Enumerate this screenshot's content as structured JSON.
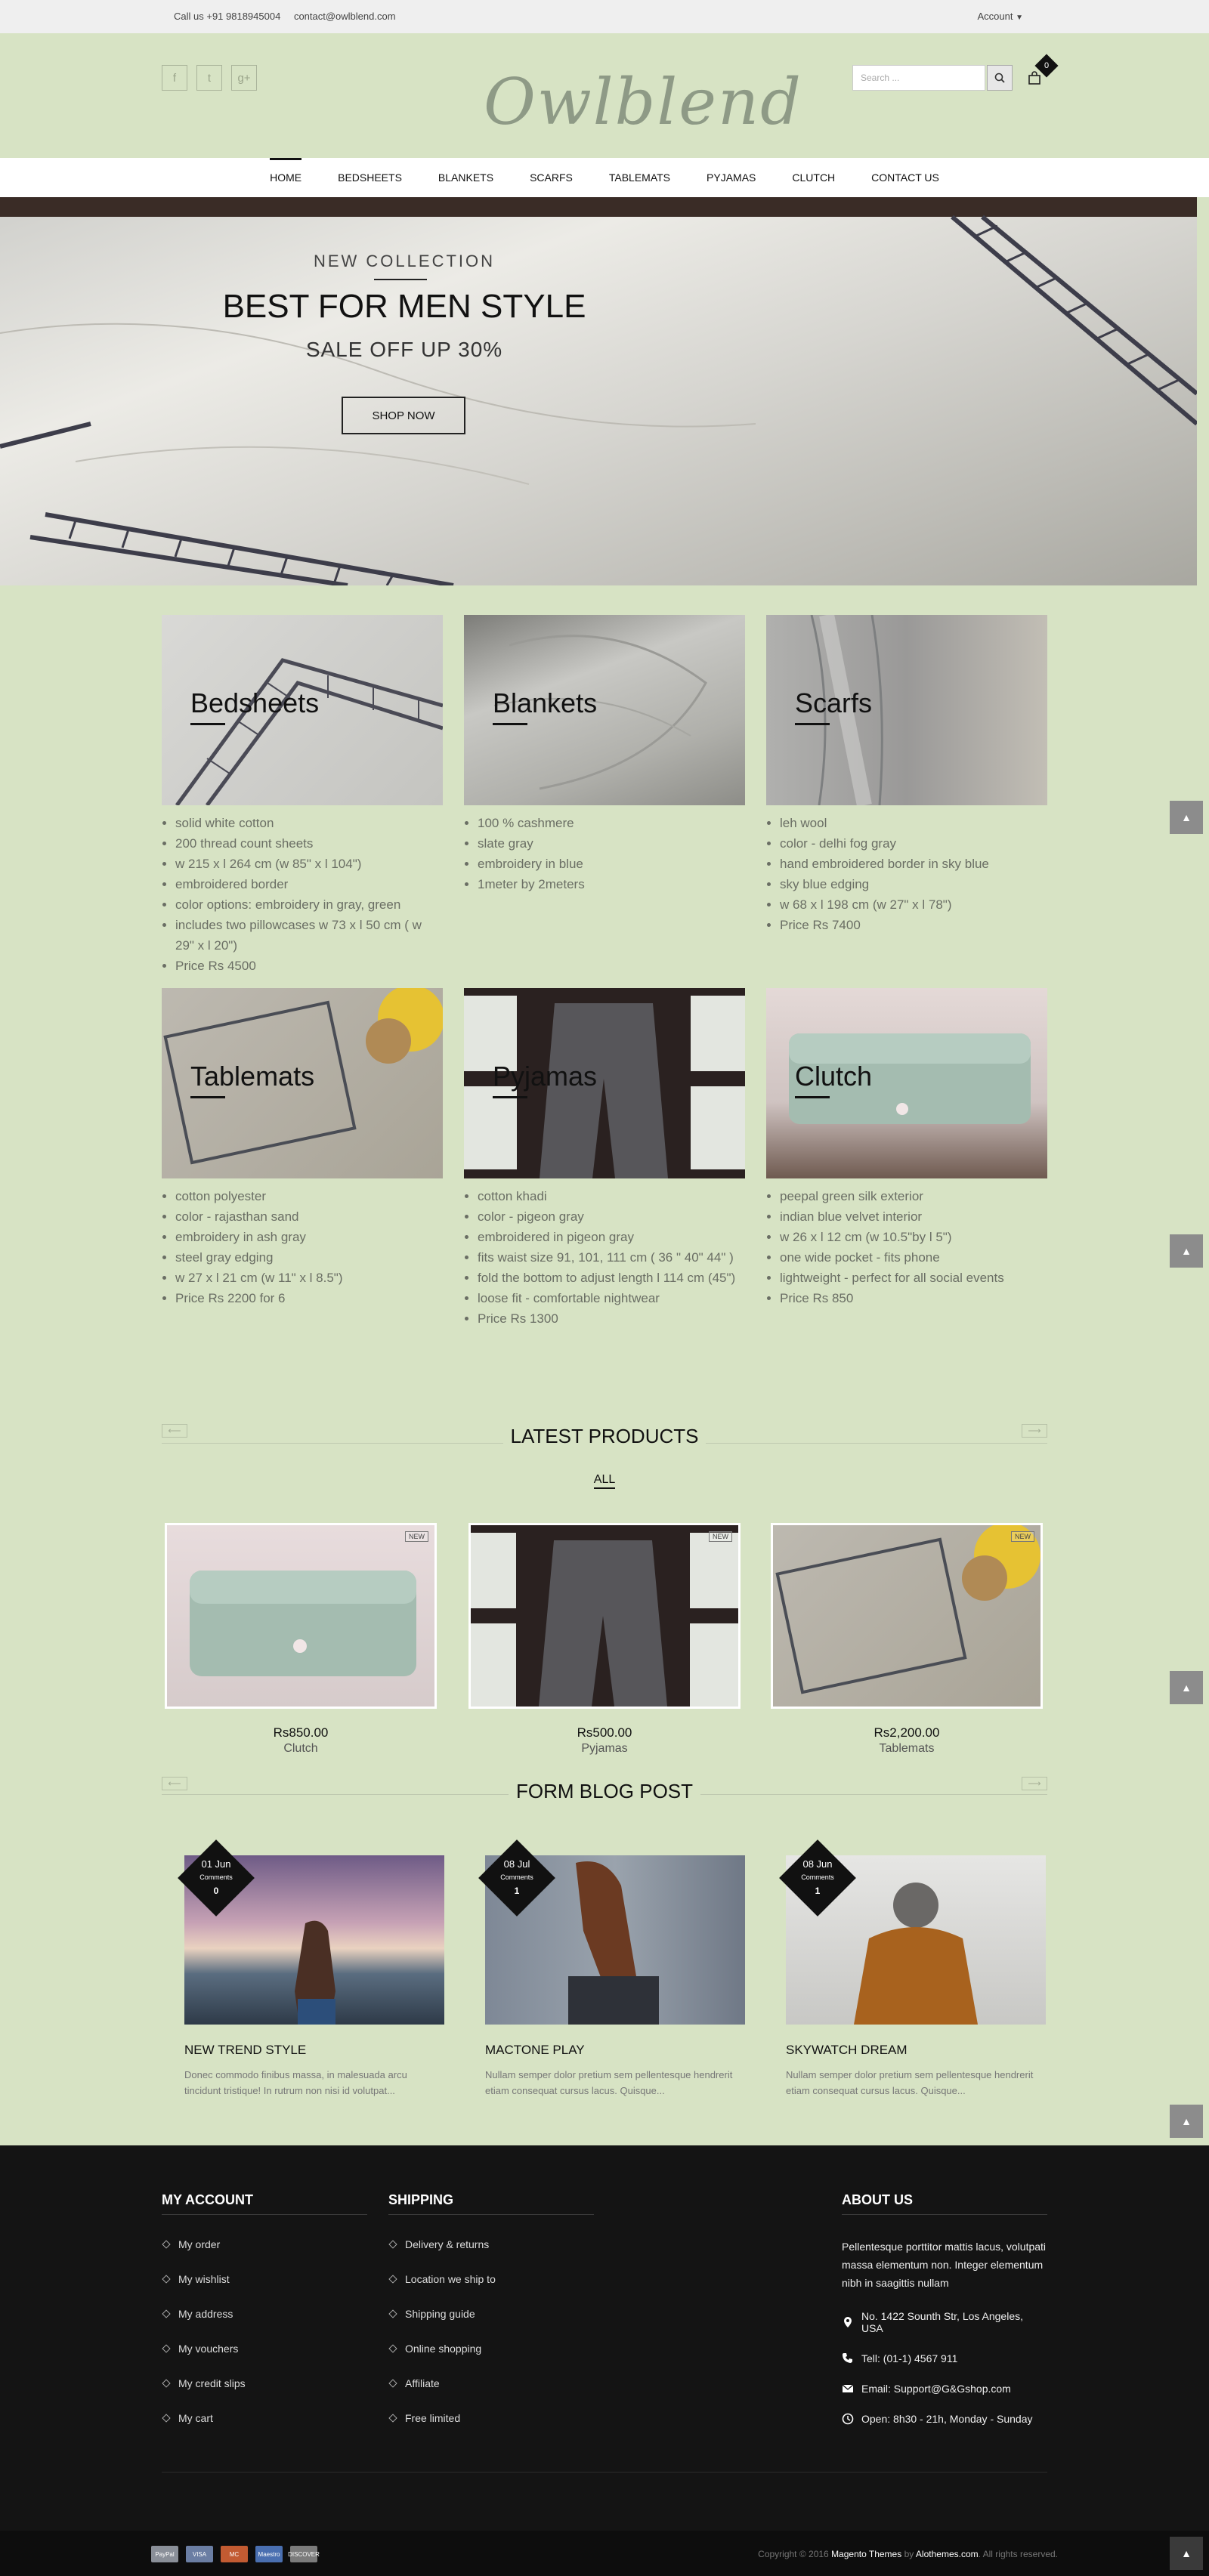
{
  "topbar": {
    "phone": "Call us +91 9818945004",
    "email": "contact@owlblend.com",
    "account": "Account"
  },
  "header": {
    "logo": "Owlblend",
    "search_placeholder": "Search ...",
    "cart_count": "0"
  },
  "nav": [
    "HOME",
    "BEDSHEETS",
    "BLANKETS",
    "SCARFS",
    "TABLEMATS",
    "PYJAMAS",
    "CLUTCH",
    "CONTACT US"
  ],
  "hero": {
    "subtitle": "NEW COLLECTION",
    "title": "BEST FOR MEN STYLE",
    "sale": "SALE OFF UP 30%",
    "button": "SHOP NOW"
  },
  "categories": [
    {
      "name": "Bedsheets",
      "items": [
        "solid white cotton",
        "200 thread count sheets",
        "w 215 x l 264 cm (w 85\" x l 104\")",
        "embroidered border",
        "color options: embroidery in gray, green",
        "includes two pillowcases w 73 x l 50 cm ( w 29\" x l 20\")",
        "Price Rs 4500"
      ]
    },
    {
      "name": "Blankets",
      "items": [
        "100 % cashmere",
        "slate gray",
        "embroidery in blue",
        "1meter by 2meters"
      ]
    },
    {
      "name": "Scarfs",
      "items": [
        "leh wool",
        "color - delhi fog gray",
        "hand embroidered border in sky blue",
        "sky blue edging",
        "w 68 x l 198 cm (w 27\" x l 78\")",
        "Price Rs 7400"
      ]
    },
    {
      "name": "Tablemats",
      "items": [
        "cotton polyester",
        "color - rajasthan sand",
        "embroidery in ash gray",
        "steel gray edging",
        "w 27 x l 21 cm (w 11\" x l 8.5\")",
        "Price Rs 2200 for 6"
      ]
    },
    {
      "name": "Pyjamas",
      "items": [
        "cotton khadi",
        "color - pigeon gray",
        "embroidered in pigeon gray",
        "fits waist size 91, 101, 111 cm ( 36 \" 40\" 44\" )",
        "fold the bottom to adjust length l 114 cm (45\")",
        "loose fit - comfortable nightwear",
        "Price Rs 1300"
      ]
    },
    {
      "name": "Clutch",
      "items": [
        "peepal green silk exterior",
        "indian blue velvet interior",
        "w 26 x l 12 cm (w 10.5\"by l 5\")",
        "one wide pocket - fits phone",
        "lightweight - perfect for all social events",
        "Price Rs 850"
      ]
    }
  ],
  "latest": {
    "title": "LATEST PRODUCTS",
    "tab": "ALL",
    "products": [
      {
        "price": "Rs850.00",
        "name": "Clutch",
        "badge": "NEW"
      },
      {
        "price": "Rs500.00",
        "name": "Pyjamas",
        "badge": "NEW"
      },
      {
        "price": "Rs2,200.00",
        "name": "Tablemats",
        "badge": "NEW"
      }
    ]
  },
  "blog": {
    "title": "FORM BLOG POST",
    "posts": [
      {
        "date": "01 Jun",
        "comments_label": "Comments",
        "comments": "0",
        "title": "NEW TREND STYLE",
        "excerpt": "Donec commodo finibus massa, in malesuada arcu tincidunt tristique! In rutrum non nisi id volutpat..."
      },
      {
        "date": "08 Jul",
        "comments_label": "Comments",
        "comments": "1",
        "title": "MACTONE PLAY",
        "excerpt": "Nullam semper dolor pretium sem pellentesque hendrerit etiam consequat cursus lacus. Quisque..."
      },
      {
        "date": "08 Jun",
        "comments_label": "Comments",
        "comments": "1",
        "title": "SKYWATCH DREAM",
        "excerpt": "Nullam semper dolor pretium sem pellentesque hendrerit etiam consequat cursus lacus. Quisque..."
      }
    ]
  },
  "footer": {
    "my_account": {
      "title": "MY ACCOUNT",
      "links": [
        "My order",
        "My wishlist",
        "My address",
        "My vouchers",
        "My credit slips",
        "My cart"
      ]
    },
    "shipping": {
      "title": "SHIPPING",
      "links": [
        "Delivery & returns",
        "Location we ship to",
        "Shipping guide",
        "Online shopping",
        "Affiliate",
        "Free limited"
      ]
    },
    "about": {
      "title": "ABOUT US",
      "text": "Pellentesque porttitor mattis lacus, volutpati massa elementum non. Integer elementum nibh in saagittis nullam",
      "address": "No. 1422 Sounth Str, Los Angeles, USA",
      "tel": "Tell: (01-1) 4567 911",
      "email": "Email: Support@G&Gshop.com",
      "open": "Open: 8h30 - 21h, Monday - Sunday"
    },
    "payments": [
      "PayPal",
      "VISA",
      "MC",
      "Maestro",
      "DISCOVER"
    ],
    "copyright_pre": "Copyright © 2016 ",
    "copyright_brand": "Magento Themes",
    "copyright_mid": " by ",
    "copyright_author": "Alothemes.com",
    "copyright_post": ". All rights reserved."
  },
  "colors": {
    "page_bg": "#d7e3c4",
    "footer_bg": "#141414",
    "accent": "#111111"
  }
}
